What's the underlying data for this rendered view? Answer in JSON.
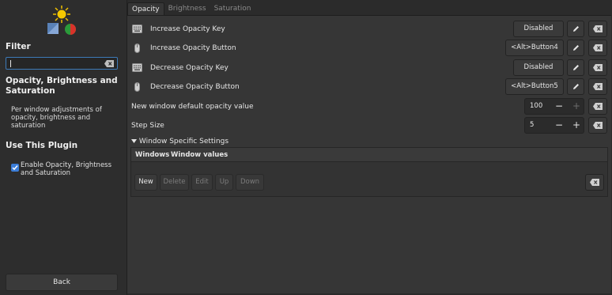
{
  "sidebar": {
    "filter_heading": "Filter",
    "filter_value": "",
    "plugin_title": "Opacity, Brightness and Saturation",
    "plugin_description": "Per window adjustments of opacity, brightness and saturation",
    "use_heading": "Use This Plugin",
    "enable_label": "Enable Opacity, Brightness and Saturation",
    "enable_checked": true,
    "back_label": "Back"
  },
  "tabs": [
    "Opacity",
    "Brightness",
    "Saturation"
  ],
  "active_tab": "Opacity",
  "settings": {
    "increase_key": {
      "label": "Increase Opacity Key",
      "value": "Disabled"
    },
    "increase_button": {
      "label": "Increase Opacity Button",
      "value": "<Alt>Button4"
    },
    "decrease_key": {
      "label": "Decrease Opacity Key",
      "value": "Disabled"
    },
    "decrease_button": {
      "label": "Decrease Opacity Button",
      "value": "<Alt>Button5"
    },
    "default_opacity": {
      "label": "New window default opacity value",
      "value": "100"
    },
    "step_size": {
      "label": "Step Size",
      "value": "5"
    }
  },
  "window_specific": {
    "title": "Window Specific Settings",
    "columns": [
      "Windows",
      "Window values"
    ],
    "buttons": {
      "new": "New",
      "delete": "Delete",
      "edit": "Edit",
      "up": "Up",
      "down": "Down"
    }
  },
  "spin_symbols": {
    "minus": "−",
    "plus": "+"
  },
  "colors": {
    "accent": "#3b7dd8",
    "panel": "#363636",
    "sidebar": "#2d2d2d"
  }
}
